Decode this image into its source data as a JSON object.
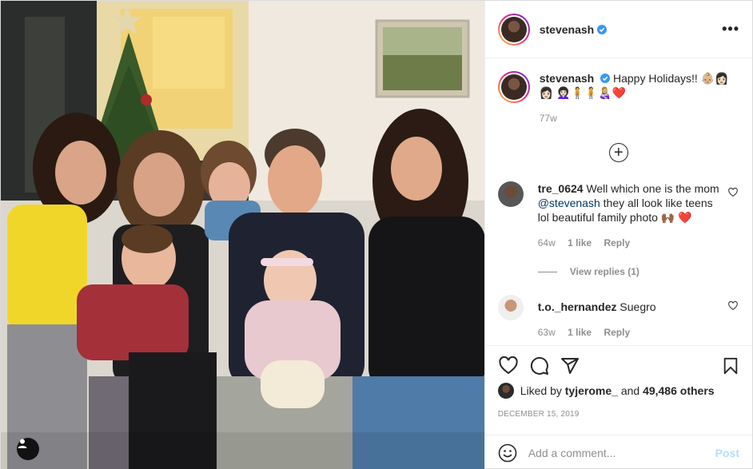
{
  "post": {
    "image_alt": "Family holiday photo",
    "author": "stevenash",
    "verified": true,
    "caption": {
      "username": "stevenash",
      "text": "Happy Holidays!! 👶🏼👩🏻👩🏻 👩🏻‍🦱🧍🧍👩🏼‍🍼❤️",
      "time": "77w"
    },
    "comments": [
      {
        "username": "tre_0624",
        "text_before": "Well which one is the mom",
        "mention": "@stevenash",
        "text_after": "they all look like teens lol beautiful family photo 🙌🏾 ❤️",
        "time": "64w",
        "likes": "1 like",
        "reply": "Reply",
        "view_replies": "View replies (1)"
      },
      {
        "username": "t.o._hernandez",
        "text": "Suegro",
        "time": "63w",
        "likes": "1 like",
        "reply": "Reply"
      }
    ],
    "likes": {
      "label": "Liked by",
      "user": "tyjerome_",
      "and": "and",
      "others": "49,486 others"
    },
    "date": "DECEMBER 15, 2019",
    "comment_input": {
      "placeholder": "Add a comment..."
    },
    "post_button": "Post",
    "icons": {
      "more": "more-options-icon",
      "like": "heart-icon",
      "comment": "comment-icon",
      "share": "share-icon",
      "save": "bookmark-icon",
      "emoji": "emoji-icon",
      "tagged": "tagged-user-icon"
    },
    "colors": {
      "link": "#00376b",
      "muted": "#8e8e8e",
      "post_button": "#b2dffc",
      "verified": "#3897f0"
    }
  }
}
